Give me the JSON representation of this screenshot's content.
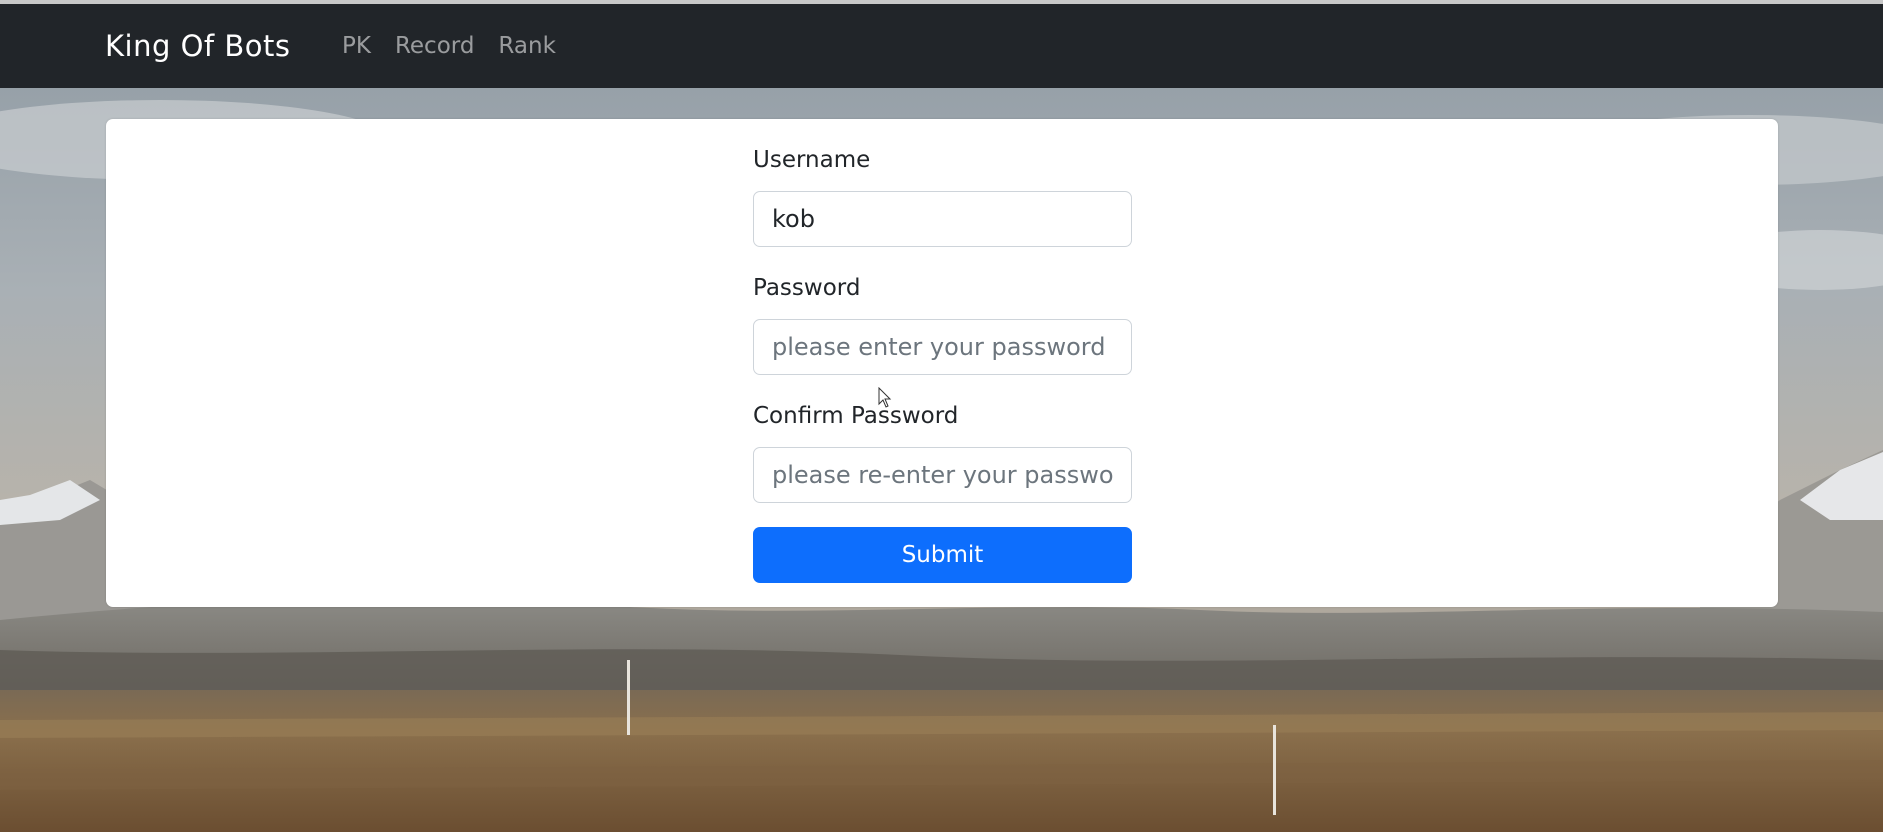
{
  "navbar": {
    "brand": "King Of Bots",
    "links": [
      "PK",
      "Record",
      "Rank"
    ]
  },
  "form": {
    "username": {
      "label": "Username",
      "value": "kob"
    },
    "password": {
      "label": "Password",
      "placeholder": "please enter your password"
    },
    "confirm_password": {
      "label": "Confirm Password",
      "placeholder": "please re-enter your password"
    },
    "submit_label": "Submit"
  },
  "colors": {
    "navbar_bg": "#212529",
    "primary": "#0d6efd",
    "card_bg": "#ffffff"
  }
}
